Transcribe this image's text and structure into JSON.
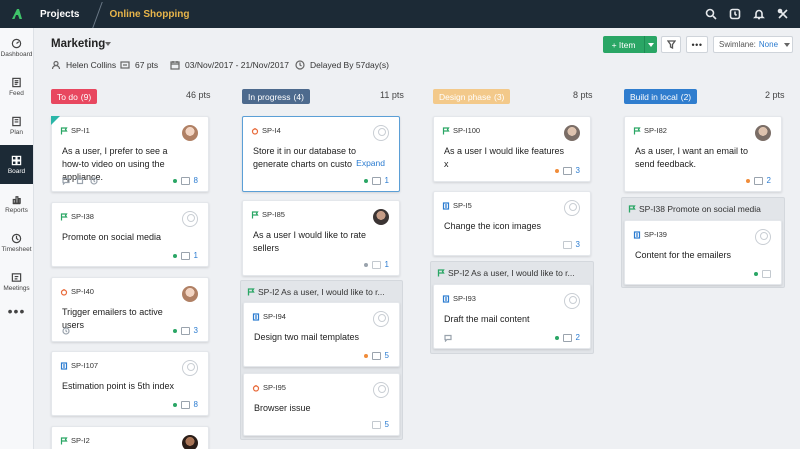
{
  "topbar": {
    "projects_label": "Projects",
    "project_name": "Online Shopping"
  },
  "sidebar": {
    "items": [
      {
        "label": "Dashboard"
      },
      {
        "label": "Feed"
      },
      {
        "label": "Plan"
      },
      {
        "label": "Board"
      },
      {
        "label": "Reports"
      },
      {
        "label": "Timesheet"
      },
      {
        "label": "Meetings"
      }
    ],
    "more": "•••"
  },
  "header": {
    "title": "Marketing",
    "owner": "Helen Collins",
    "points": "67 pts",
    "date_range": "03/Nov/2017  -  21/Nov/2017",
    "delayed": "Delayed By 57day(s)",
    "add_item": "+ Item",
    "more": "•••",
    "swimlane_label": "Swimlane:",
    "swimlane_value": "None"
  },
  "columns": [
    {
      "status": "To do",
      "count": "(9)",
      "points": "46 pts",
      "color": "#e8475f"
    },
    {
      "status": "In progress",
      "count": "(4)",
      "points": "11 pts",
      "color": "#4d6a8d"
    },
    {
      "status": "Design phase",
      "count": "(3)",
      "points": "8 pts",
      "color": "#f3c98a"
    },
    {
      "status": "Build in local",
      "count": "(2)",
      "points": "2 pts",
      "color": "#2f7dce"
    }
  ],
  "cards": {
    "todo": [
      {
        "id": "SP-I1",
        "title": "As a user, I prefer to see a how-to video on using the appliance.",
        "points": "8"
      },
      {
        "id": "SP-I38",
        "title": "Promote on social media",
        "points": "1"
      },
      {
        "id": "SP-I40",
        "title": "Trigger emailers to active users",
        "points": "3"
      },
      {
        "id": "SP-I107",
        "title": "Estimation point is 5th index",
        "points": "8"
      },
      {
        "id": "SP-I2",
        "title": ""
      }
    ],
    "inprogress": [
      {
        "id": "SP-I4",
        "title": "Store it in our database to generate charts on custom",
        "expand": "Expand",
        "points": "1"
      },
      {
        "id": "SP-I85",
        "title": "As a user I would like to rate sellers",
        "points": "1"
      }
    ],
    "inprogress_group": {
      "title": "SP-I2  As a user, I would like to r...",
      "cards": [
        {
          "id": "SP-I94",
          "title": "Design two mail templates",
          "points": "5"
        },
        {
          "id": "SP-I95",
          "title": "Browser issue",
          "points": "5"
        }
      ]
    },
    "design": [
      {
        "id": "SP-I100",
        "title": "As a user I would like features x",
        "points": "3"
      },
      {
        "id": "SP-I5",
        "title": "Change the icon images",
        "points": "3"
      }
    ],
    "design_group": {
      "title": "SP-I2  As a user, I would like to r...",
      "cards": [
        {
          "id": "SP-I93",
          "title": "Draft the mail content",
          "points": "2"
        }
      ]
    },
    "build": [
      {
        "id": "SP-I82",
        "title": "As a user, I want an email to send feedback.",
        "points": "2"
      }
    ],
    "build_group": {
      "title": "SP-I38  Promote on social media",
      "cards": [
        {
          "id": "SP-I39",
          "title": "Content for the emailers",
          "points": ""
        }
      ]
    }
  }
}
